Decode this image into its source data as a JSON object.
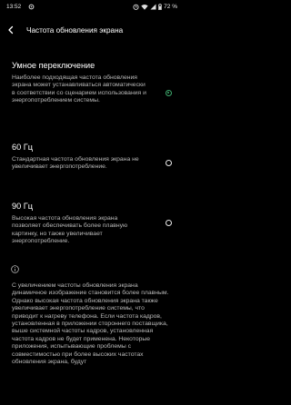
{
  "status": {
    "time": "13:52",
    "battery": "72 %",
    "icons": [
      "gear-icon",
      "alarm-icon",
      "wifi-icon",
      "signal-icon",
      "battery-icon"
    ]
  },
  "header": {
    "title": "Частота обновления экрана",
    "back_icon": "arrow-left-icon"
  },
  "options": [
    {
      "title": "Умное переключение",
      "description": "Наиболее подходящая частота обновления экрана может устанавливаться автоматически в соответствии со сценарием использования и энергопотреблением системы.",
      "selected": true
    },
    {
      "title": "60 Гц",
      "description": "Стандартная частота обновления экрана не увеличивает энергопотребление.",
      "selected": false
    },
    {
      "title": "90 Гц",
      "description": "Высокая частота обновления экрана позволяет обеспечивать более плавную картинку, но также увеличивает энергопотребление.",
      "selected": false
    }
  ],
  "info": {
    "icon": "info-icon",
    "text": "С увеличением частоты обновления экрана динамичное изображение становится более плавным. Однако высокая частота обновления экрана также увеличивает энергопотребление системы, что приводит к нагреву телефона. Если частота кадров, установленная в приложении стороннего поставщика, выше системной частоты кадров, установленная частота кадров не будет применена. Некоторые приложения, испытывающие проблемы с совместимостью при более высоких частотах обновления экрана, будут"
  },
  "colors": {
    "background": "#000000",
    "accent": "#3ea96d",
    "text_primary": "#ffffff",
    "text_secondary": "#b9b9b9"
  }
}
